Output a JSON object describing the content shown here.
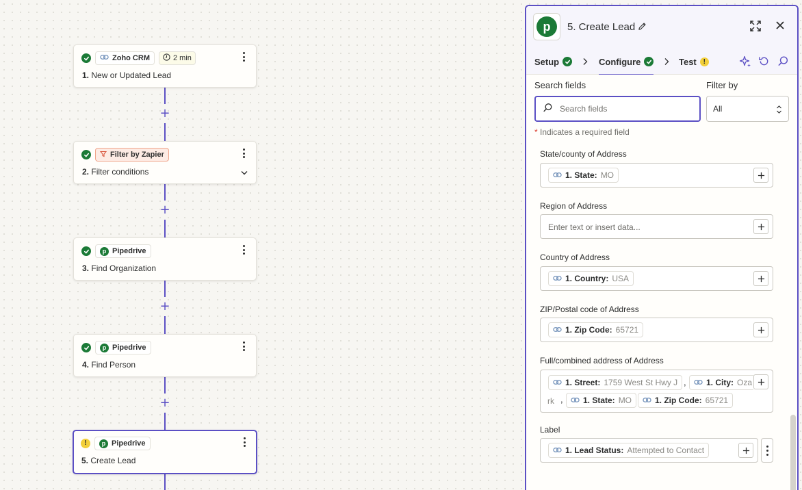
{
  "colors": {
    "accent": "#5b4fc4",
    "success": "#1b7a36",
    "warning": "#f2cf3a",
    "filter_chip": "#fdebe4"
  },
  "steps": [
    {
      "number": "1.",
      "title": "New or Updated Lead",
      "app": "Zoho CRM",
      "app_icon": "link-icon",
      "status": "success",
      "time_badge": "2 min"
    },
    {
      "number": "2.",
      "title": "Filter conditions",
      "app": "Filter by Zapier",
      "app_icon": "filter-icon",
      "status": "success",
      "expandable": true
    },
    {
      "number": "3.",
      "title": "Find Organization",
      "app": "Pipedrive",
      "app_icon": "pipedrive-logo",
      "status": "success"
    },
    {
      "number": "4.",
      "title": "Find Person",
      "app": "Pipedrive",
      "app_icon": "pipedrive-logo",
      "status": "success"
    },
    {
      "number": "5.",
      "title": "Create Lead",
      "app": "Pipedrive",
      "app_icon": "pipedrive-logo",
      "status": "warning",
      "selected": true
    }
  ],
  "connector_plus": "+",
  "panel": {
    "logo_letter": "p",
    "title": "5. Create Lead",
    "tabs": [
      {
        "label": "Setup",
        "status": "success"
      },
      {
        "label": "Configure",
        "status": "success",
        "active": true
      },
      {
        "label": "Test",
        "status": "warning"
      }
    ],
    "search": {
      "label": "Search fields",
      "placeholder": "Search fields",
      "value": ""
    },
    "filter": {
      "label": "Filter by",
      "value": "All"
    },
    "required_note": {
      "star": "*",
      "text": " Indicates a required field"
    },
    "fields": [
      {
        "label": "State/county of Address",
        "pills": [
          {
            "key": "1. State:",
            "value": "MO"
          }
        ]
      },
      {
        "label": "Region of Address",
        "placeholder": "Enter text or insert data..."
      },
      {
        "label": "Country of Address",
        "pills": [
          {
            "key": "1. Country:",
            "value": "USA"
          }
        ]
      },
      {
        "label": "ZIP/Postal code of Address",
        "pills": [
          {
            "key": "1. Zip Code:",
            "value": "65721"
          }
        ]
      },
      {
        "label": "Full/combined address of Address",
        "pills": [
          {
            "key": "1. Street:",
            "value": "1759 West St Hwy J"
          },
          {
            "key": "1. City:",
            "value": "Oza"
          },
          {
            "key": "1. State:",
            "value": "MO"
          },
          {
            "key": "1. Zip Code:",
            "value": "65721"
          }
        ],
        "wrap_continuation": "rk",
        "separator": ","
      },
      {
        "label": "Label",
        "pills": [
          {
            "key": "1. Lead Status:",
            "value": "Attempted to Contact"
          }
        ]
      }
    ]
  }
}
